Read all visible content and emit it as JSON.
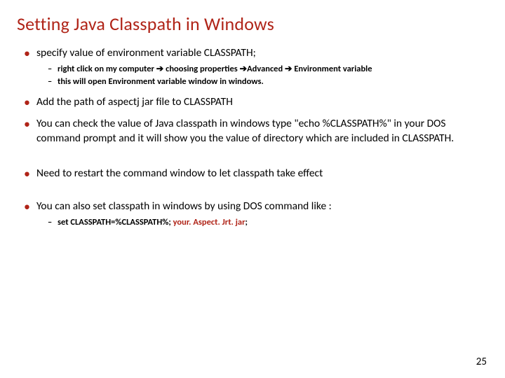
{
  "title": "Setting Java Classpath in Windows",
  "bullets": {
    "b1": "specify value of environment variable CLASSPATH;",
    "b1s1a": "right click on my computer ",
    "b1s1b": " choosing properties ",
    "b1s1c": "Advanced ",
    "b1s1d": " Environment variable",
    "b1s2": "this will open Environment variable window in windows.",
    "b2": "Add the path of aspectj jar file to CLASSPATH",
    "b3": "You can check the value of Java classpath in windows type \"echo %CLASSPATH%\" in your DOS command prompt and it will show you the value of directory which are included in CLASSPATH.",
    "b4": "Need to restart the command window to let classpath take effect",
    "b5": "You can also set classpath in windows by using DOS command like :",
    "b5s1a": "set CLASSPATH=%CLASSPATH%; ",
    "b5s1b": "your. Aspect. Jrt. jar",
    "b5s1c": ";"
  },
  "symbols": {
    "arrow": "➔"
  },
  "pageNumber": "25"
}
